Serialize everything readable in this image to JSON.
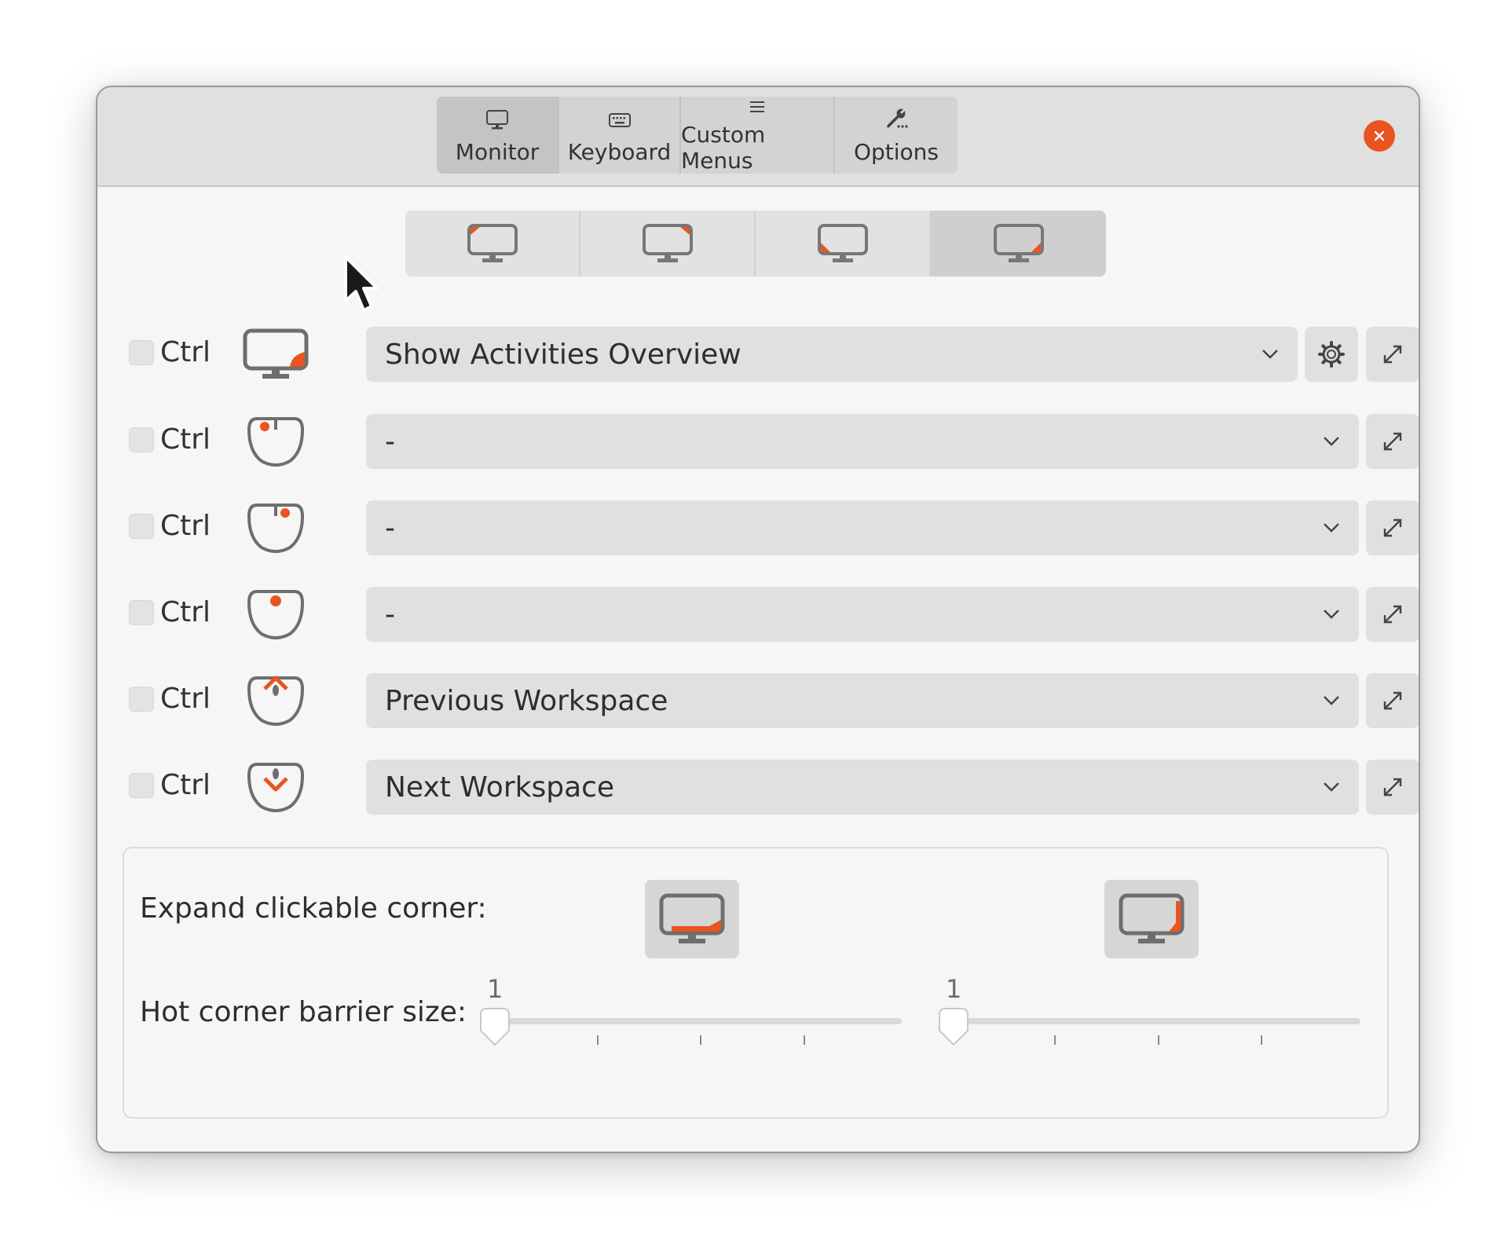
{
  "tabs": [
    {
      "label": "Monitor",
      "icon": "monitor-icon",
      "active": true
    },
    {
      "label": "Keyboard",
      "icon": "keyboard-icon",
      "active": false
    },
    {
      "label": "Custom Menus",
      "icon": "menu-icon",
      "active": false
    },
    {
      "label": "Options",
      "icon": "wrench-icon",
      "active": false
    }
  ],
  "close_button": {
    "icon": "close-icon",
    "color": "#e95420"
  },
  "corner_selector": [
    {
      "corner": "top-left",
      "active": false
    },
    {
      "corner": "top-right",
      "active": false
    },
    {
      "corner": "bottom-left",
      "active": false
    },
    {
      "corner": "bottom-right",
      "active": true
    }
  ],
  "actions": [
    {
      "modifier": "Ctrl",
      "trigger": "monitor-bottom-right-corner-icon",
      "action": "Show Activities Overview",
      "has_settings": true
    },
    {
      "modifier": "Ctrl",
      "trigger": "mouse-left-click-icon",
      "action": "-",
      "has_settings": false
    },
    {
      "modifier": "Ctrl",
      "trigger": "mouse-right-click-icon",
      "action": "-",
      "has_settings": false
    },
    {
      "modifier": "Ctrl",
      "trigger": "mouse-middle-click-icon",
      "action": "-",
      "has_settings": false
    },
    {
      "modifier": "Ctrl",
      "trigger": "mouse-scroll-up-icon",
      "action": "Previous Workspace",
      "has_settings": false
    },
    {
      "modifier": "Ctrl",
      "trigger": "mouse-scroll-down-icon",
      "action": "Next Workspace",
      "has_settings": false
    }
  ],
  "expand_section": {
    "expand_label": "Expand clickable corner:",
    "barrier_label": "Hot corner barrier size:",
    "horizontal_slider_value": "1",
    "vertical_slider_value": "1"
  },
  "colors": {
    "accent": "#e95420",
    "icon_gray": "#6e6e6e"
  }
}
